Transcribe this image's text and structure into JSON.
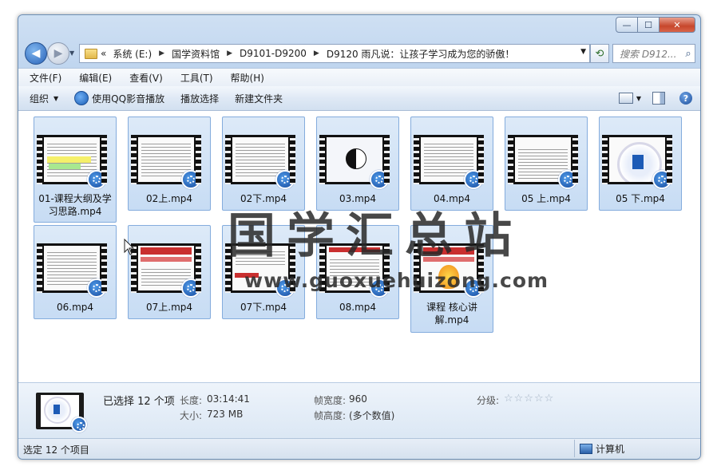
{
  "window": {
    "caption_buttons": {
      "minimize": "—",
      "maximize": "☐",
      "close": "✕"
    }
  },
  "address": {
    "prefix": "«",
    "crumbs": [
      "系统 (E:)",
      "国学资料馆",
      "D9101-D9200",
      "D9120 雨凡说：让孩子学习成为您的骄傲！"
    ],
    "search_placeholder": "搜索 D912..."
  },
  "menu": [
    "文件(F)",
    "编辑(E)",
    "查看(V)",
    "工具(T)",
    "帮助(H)"
  ],
  "commands": {
    "organize": "组织",
    "play_qq": "使用QQ影音播放",
    "play_selection": "播放选择",
    "new_folder": "新建文件夹"
  },
  "files": [
    {
      "name": "01-课程大纲及学习思路.mp4",
      "thumb": "doc-highlight"
    },
    {
      "name": "02上.mp4",
      "thumb": "doc"
    },
    {
      "name": "02下.mp4",
      "thumb": "doc"
    },
    {
      "name": "03.mp4",
      "thumb": "yinyang"
    },
    {
      "name": "04.mp4",
      "thumb": "doc"
    },
    {
      "name": "05 上.mp4",
      "thumb": "doc"
    },
    {
      "name": "05 下.mp4",
      "thumb": "dial"
    },
    {
      "name": "06.mp4",
      "thumb": "doc"
    },
    {
      "name": "07上.mp4",
      "thumb": "red"
    },
    {
      "name": "07下.mp4",
      "thumb": "red-doc"
    },
    {
      "name": "08.mp4",
      "thumb": "red-doc"
    },
    {
      "name": "课程 核心讲解.mp4",
      "thumb": "red-flame"
    }
  ],
  "watermark": {
    "title": "国学汇总站",
    "url": "www.guoxuehuizong.com"
  },
  "details": {
    "selected": "已选择 12 个项",
    "length_label": "长度:",
    "length": "03:14:41",
    "size_label": "大小:",
    "size": "723 MB",
    "width_label": "帧宽度:",
    "width": "960",
    "height_label": "帧高度:",
    "height": "(多个数值)",
    "rating_label": "分级:",
    "rating_stars": "☆☆☆☆☆"
  },
  "status": {
    "left": "选定 12 个项目",
    "right": "计算机"
  },
  "colors": {
    "selection_fill": "#c7dcf4",
    "selection_border": "#84acdd",
    "chrome": "#bcd3ee"
  }
}
